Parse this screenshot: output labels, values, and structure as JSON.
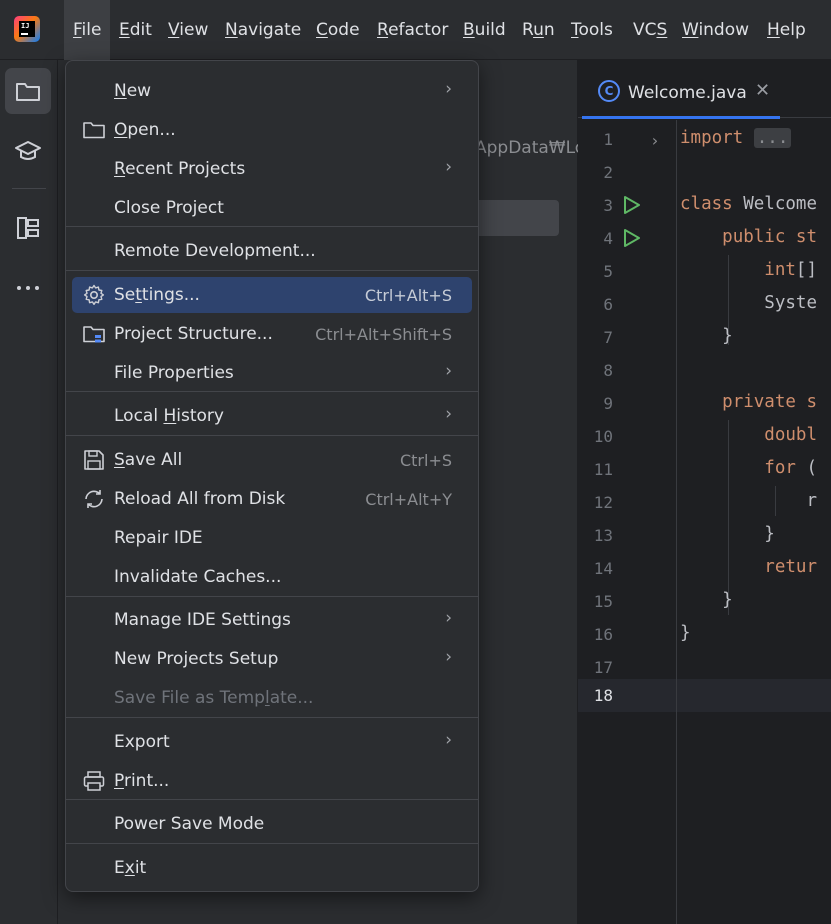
{
  "menubar": {
    "items": [
      {
        "label": "File",
        "mn": "F",
        "rest": "ile"
      },
      {
        "label": "Edit",
        "mn": "E",
        "rest": "dit"
      },
      {
        "label": "View",
        "mn": "V",
        "rest": "iew"
      },
      {
        "label": "Navigate",
        "mn": "N",
        "rest": "avigate"
      },
      {
        "label": "Code",
        "mn": "C",
        "rest": "ode"
      },
      {
        "label": "Refactor",
        "mn": "R",
        "rest": "efactor"
      },
      {
        "label": "Build",
        "mn": "B",
        "rest": "uild"
      },
      {
        "label": "Run",
        "pre": "R",
        "mn": "u",
        "rest": "n"
      },
      {
        "label": "Tools",
        "mn": "T",
        "rest": "ools"
      },
      {
        "label": "VCS",
        "pre": "VC",
        "mn": "S",
        "rest": ""
      },
      {
        "label": "Window",
        "mn": "W",
        "rest": "indow"
      },
      {
        "label": "Help",
        "mn": "H",
        "rest": "elp"
      }
    ]
  },
  "project_panel": {
    "path_fragment": "AppData₩Lo"
  },
  "editor": {
    "tab_label": "Welcome.java",
    "tab_icon": "class-icon",
    "line_numbers": [
      "1",
      "2",
      "3",
      "4",
      "5",
      "6",
      "7",
      "8",
      "9",
      "10",
      "11",
      "12",
      "13",
      "14",
      "15",
      "16",
      "17",
      "18"
    ],
    "current_line": "18",
    "code": {
      "l1_kw": "import",
      "l1_fold": "...",
      "l4_kw": "class",
      "l4_rest": " Welcome",
      "l5_kw": "public st",
      "l6_kw": "int",
      "l6_rest": "[]",
      "l7": "Syste",
      "l8": "}",
      "l10_kw": "private s",
      "l11_kw": "doubl",
      "l12_kw": "for",
      "l12_rest": " (",
      "l13": "r",
      "l14": "}",
      "l15_kw": "retur",
      "l16": "}",
      "l17": "}"
    }
  },
  "file_menu": {
    "new": {
      "mn": "N",
      "rest": "ew"
    },
    "open": {
      "mn": "O",
      "rest": "pen..."
    },
    "recent": {
      "mn": "R",
      "rest": "ecent Projects"
    },
    "close": "Close Project",
    "remote": "Remote Development...",
    "settings": {
      "pre": "Se",
      "mn": "t",
      "rest": "tings...",
      "shortcut": "Ctrl+Alt+S"
    },
    "project_structure": {
      "label": "Project Structure...",
      "shortcut": "Ctrl+Alt+Shift+S"
    },
    "file_properties": "File Properties",
    "local_history": {
      "pre": "Local ",
      "mn": "H",
      "rest": "istory"
    },
    "save_all": {
      "mn": "S",
      "rest": "ave All",
      "shortcut": "Ctrl+S"
    },
    "reload": {
      "label": "Reload All from Disk",
      "shortcut": "Ctrl+Alt+Y"
    },
    "repair": "Repair IDE",
    "invalidate": "Invalidate Caches...",
    "manage": "Manage IDE Settings",
    "new_projects_setup": "New Projects Setup",
    "save_template": {
      "pre": "Save File as Temp",
      "mn": "l",
      "rest": "ate..."
    },
    "export": "Export",
    "print": {
      "mn": "P",
      "rest": "rint..."
    },
    "power_save": "Power Save Mode",
    "exit": {
      "pre": "E",
      "mn": "x",
      "rest": "it"
    },
    "arrow": "›"
  },
  "colors": {
    "accent": "#3574f0",
    "highlight": "#2e436e",
    "keyword": "#cf8e6d",
    "run_green": "#5fb865"
  }
}
